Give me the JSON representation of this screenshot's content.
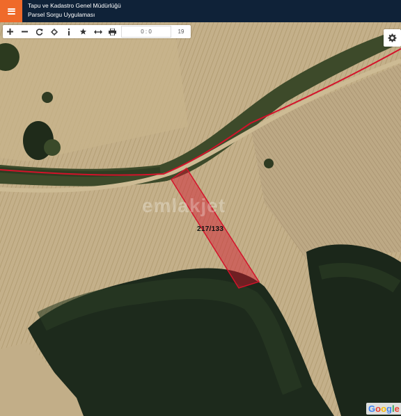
{
  "header": {
    "title_line1": "Tapu ve Kadastro Genel Müdürlüğü",
    "title_line2": "Parsel Sorgu Uygulaması",
    "menu_icon": "hamburger-menu-icon",
    "bg_color": "#0f2238",
    "accent_color": "#ef6a2a"
  },
  "toolbar": {
    "tools": [
      "zoom-in-icon",
      "zoom-out-icon",
      "refresh-icon",
      "locate-icon",
      "info-icon",
      "favorite-icon",
      "measure-icon",
      "print-icon"
    ],
    "coordinate": "0 : 0",
    "zoom_level": "19"
  },
  "map": {
    "parcel_label": "217/133",
    "parcel_color": "#d4122a",
    "watermark": "emlakjet",
    "attribution": "Google",
    "settings_icon": "gear-icon"
  }
}
